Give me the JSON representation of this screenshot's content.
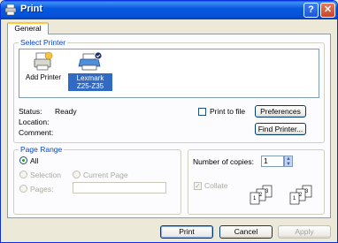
{
  "window": {
    "title": "Print"
  },
  "tabs": [
    {
      "label": "General"
    }
  ],
  "select_printer": {
    "label": "Select Printer",
    "printers": [
      {
        "label": "Add Printer",
        "selected": false
      },
      {
        "label_line1": "Lexmark",
        "label_line2": "Z25-Z35",
        "selected": true
      }
    ]
  },
  "printer_info": {
    "status_label": "Status:",
    "status_value": "Ready",
    "location_label": "Location:",
    "comment_label": "Comment:",
    "print_to_file_label": "Print to file",
    "preferences_label": "Preferences",
    "find_printer_label": "Find Printer..."
  },
  "page_range": {
    "label": "Page Range",
    "all_label": "All",
    "selection_label": "Selection",
    "current_page_label": "Current Page",
    "pages_label": "Pages:",
    "pages_value": ""
  },
  "copies": {
    "label": "Number of copies:",
    "value": "1",
    "collate_label": "Collate",
    "collate_checked": true
  },
  "footer": {
    "print_label": "Print",
    "cancel_label": "Cancel",
    "apply_label": "Apply"
  }
}
